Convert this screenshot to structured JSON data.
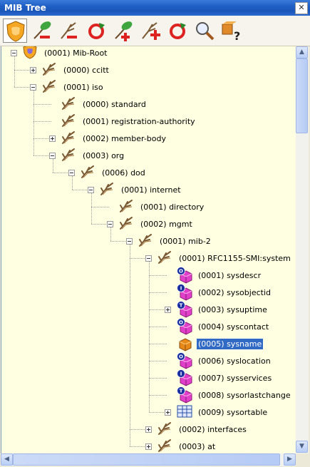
{
  "window": {
    "title": "MIB Tree",
    "close_glyph": "✕"
  },
  "toolbar": {
    "buttons": [
      {
        "name": "shield-icon",
        "tip": "MIB root"
      },
      {
        "name": "leaf-minus-icon",
        "tip": "remove leaf"
      },
      {
        "name": "branch-minus-icon",
        "tip": "remove branch"
      },
      {
        "name": "refresh-icon",
        "tip": "refresh"
      },
      {
        "name": "leaf-plus-icon",
        "tip": "add leaf"
      },
      {
        "name": "branch-plus-icon",
        "tip": "add branch"
      },
      {
        "name": "refresh-icon-2",
        "tip": "reload"
      },
      {
        "name": "magnifier-icon",
        "tip": "find"
      },
      {
        "name": "help-icon",
        "tip": "help"
      }
    ]
  },
  "tree": [
    {
      "label": "(0001) Mib-Root",
      "icon": "shield",
      "level": 0,
      "toggle": "minus"
    },
    {
      "label": "(0000) ccitt",
      "icon": "branch",
      "level": 1,
      "toggle": "plus"
    },
    {
      "label": "(0001) iso",
      "icon": "branch",
      "level": 1,
      "toggle": "minus"
    },
    {
      "label": "(0000) standard",
      "icon": "branch",
      "level": 2,
      "toggle": "none"
    },
    {
      "label": "(0001) registration-authority",
      "icon": "branch",
      "level": 2,
      "toggle": "none"
    },
    {
      "label": "(0002) member-body",
      "icon": "branch",
      "level": 2,
      "toggle": "plus"
    },
    {
      "label": "(0003) org",
      "icon": "branch",
      "level": 2,
      "toggle": "minus"
    },
    {
      "label": "(0006) dod",
      "icon": "branch",
      "level": 3,
      "toggle": "minus"
    },
    {
      "label": "(0001) internet",
      "icon": "branch",
      "level": 4,
      "toggle": "minus"
    },
    {
      "label": "(0001) directory",
      "icon": "branch",
      "level": 5,
      "toggle": "none"
    },
    {
      "label": "(0002) mgmt",
      "icon": "branch",
      "level": 5,
      "toggle": "minus"
    },
    {
      "label": "(0001) mib-2",
      "icon": "branch",
      "level": 6,
      "toggle": "minus"
    },
    {
      "label": "(0001) RFC1155-SMI:system",
      "icon": "branch",
      "level": 7,
      "toggle": "minus"
    },
    {
      "label": "(0001) sysdescr",
      "icon": "cube-o",
      "level": 8,
      "toggle": "none"
    },
    {
      "label": "(0002) sysobjectid",
      "icon": "cube-i",
      "level": 8,
      "toggle": "none"
    },
    {
      "label": "(0003) sysuptime",
      "icon": "cube-t",
      "level": 8,
      "toggle": "plus"
    },
    {
      "label": "(0004) syscontact",
      "icon": "cube-o",
      "level": 8,
      "toggle": "none"
    },
    {
      "label": "(0005) sysname",
      "icon": "cube-orange",
      "level": 8,
      "toggle": "none",
      "selected": true
    },
    {
      "label": "(0006) syslocation",
      "icon": "cube-o",
      "level": 8,
      "toggle": "none"
    },
    {
      "label": "(0007) sysservices",
      "icon": "cube-i",
      "level": 8,
      "toggle": "none"
    },
    {
      "label": "(0008) sysorlastchange",
      "icon": "cube-t",
      "level": 8,
      "toggle": "none"
    },
    {
      "label": "(0009) sysortable",
      "icon": "table",
      "level": 8,
      "toggle": "plus"
    },
    {
      "label": "(0002) interfaces",
      "icon": "branch",
      "level": 7,
      "toggle": "plus"
    },
    {
      "label": "(0003) at",
      "icon": "branch",
      "level": 7,
      "toggle": "plus"
    }
  ],
  "icon_letters": {
    "cube-o": "O",
    "cube-i": "I",
    "cube-t": "T"
  },
  "colors": {
    "selection": "#316ac5",
    "tree_bg": "#ffffe1",
    "cube": "#e040c8",
    "badge": "#1a2fa0"
  }
}
